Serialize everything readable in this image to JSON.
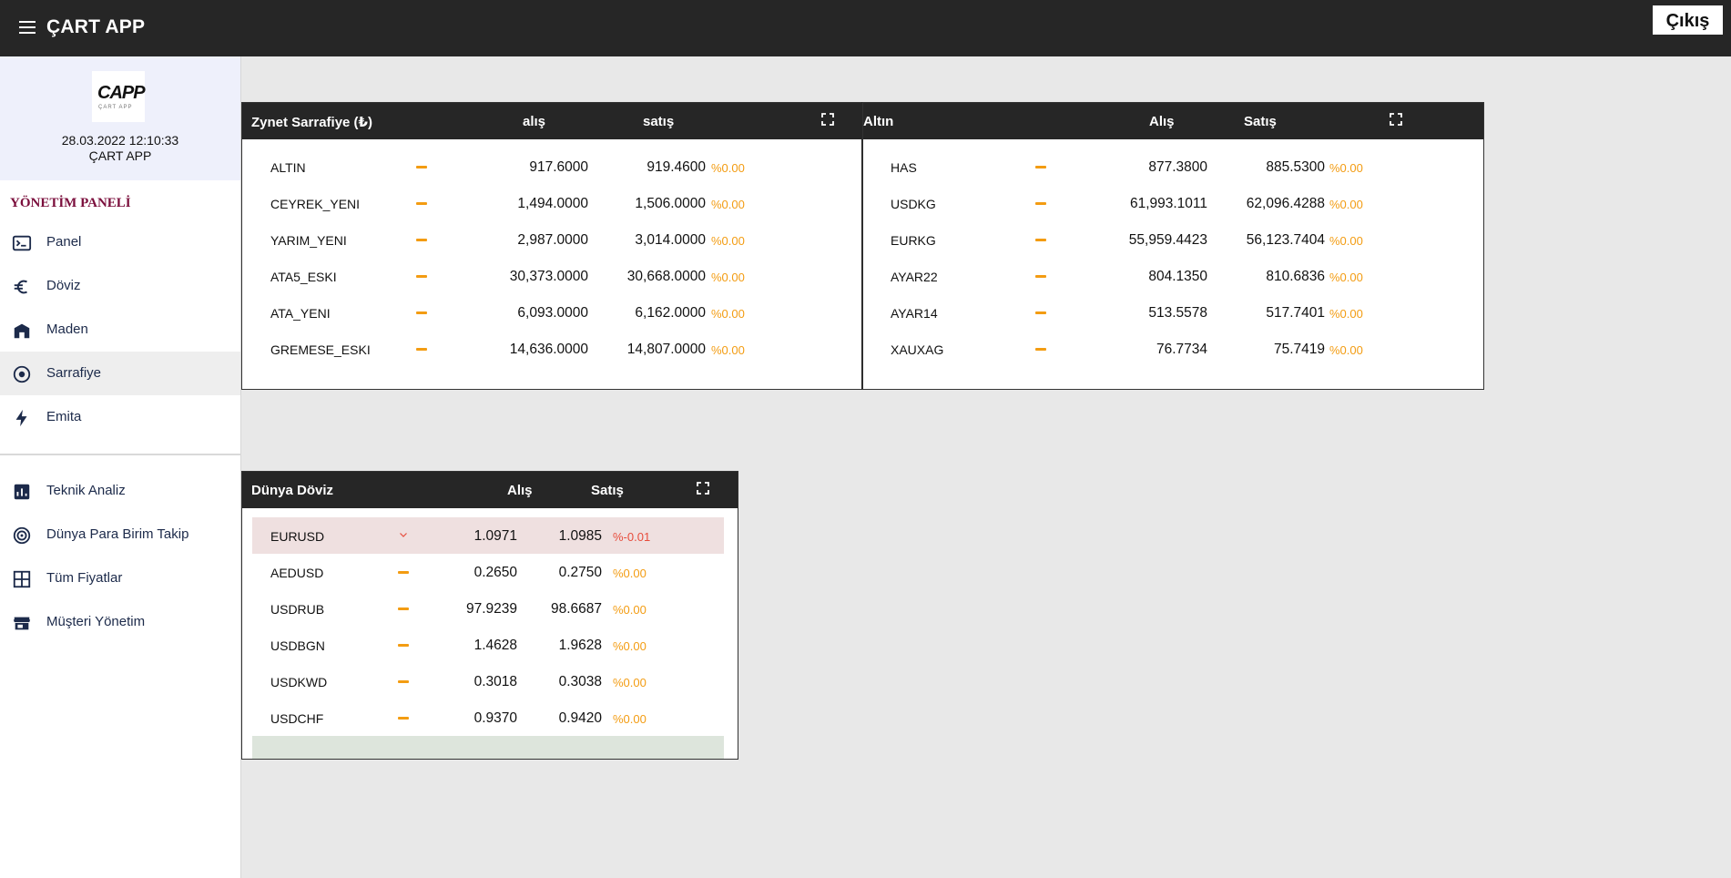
{
  "app": {
    "title": "ÇART APP",
    "logout_label": "Çıkış"
  },
  "profile": {
    "logo_text": "CAPP",
    "logo_sub": "ÇART APP",
    "datetime": "28.03.2022 12:10:33",
    "user": "ÇART APP"
  },
  "sidebar": {
    "section_title": "YÖNETİM PANELİ",
    "items": [
      {
        "label": "Panel",
        "icon": "terminal-icon"
      },
      {
        "label": "Döviz",
        "icon": "euro-icon"
      },
      {
        "label": "Maden",
        "icon": "store-icon"
      },
      {
        "label": "Sarrafiye",
        "icon": "coin-icon",
        "active": true
      },
      {
        "label": "Emita",
        "icon": "bolt-icon"
      }
    ],
    "items2": [
      {
        "label": "Teknik Analiz",
        "icon": "chart-icon"
      },
      {
        "label": "Dünya Para Birim Takip",
        "icon": "radar-icon"
      },
      {
        "label": "Tüm Fiyatlar",
        "icon": "grid-icon"
      },
      {
        "label": "Müşteri Yönetim",
        "icon": "shop-icon"
      }
    ]
  },
  "colors": {
    "topbar": "#262626",
    "neutral": "#f39c12",
    "down": "#e74c3c",
    "active_row_down": "#efe0e0",
    "row_up": "#dde5dc"
  },
  "zynet": {
    "title": "Zynet Sarrafiye (₺)",
    "buy_label": "alış",
    "sell_label": "satış",
    "rows": [
      {
        "name": "ALTIN",
        "buy": "917.6000",
        "sell": "919.4600",
        "change": "%0.00"
      },
      {
        "name": "CEYREK_YENI",
        "buy": "1,494.0000",
        "sell": "1,506.0000",
        "change": "%0.00"
      },
      {
        "name": "YARIM_YENI",
        "buy": "2,987.0000",
        "sell": "3,014.0000",
        "change": "%0.00"
      },
      {
        "name": "ATA5_ESKI",
        "buy": "30,373.0000",
        "sell": "30,668.0000",
        "change": "%0.00"
      },
      {
        "name": "ATA_YENI",
        "buy": "6,093.0000",
        "sell": "6,162.0000",
        "change": "%0.00"
      },
      {
        "name": "GREMESE_ESKI",
        "buy": "14,636.0000",
        "sell": "14,807.0000",
        "change": "%0.00"
      }
    ]
  },
  "altin": {
    "title": "Altın",
    "buy_label": "Alış",
    "sell_label": "Satış",
    "rows": [
      {
        "name": "HAS",
        "buy": "877.3800",
        "sell": "885.5300",
        "change": "%0.00"
      },
      {
        "name": "USDKG",
        "buy": "61,993.1011",
        "sell": "62,096.4288",
        "change": "%0.00"
      },
      {
        "name": "EURKG",
        "buy": "55,959.4423",
        "sell": "56,123.7404",
        "change": "%0.00"
      },
      {
        "name": "AYAR22",
        "buy": "804.1350",
        "sell": "810.6836",
        "change": "%0.00"
      },
      {
        "name": "AYAR14",
        "buy": "513.5578",
        "sell": "517.7401",
        "change": "%0.00"
      },
      {
        "name": "XAUXAG",
        "buy": "76.7734",
        "sell": "75.7419",
        "change": "%0.00"
      }
    ]
  },
  "dunya": {
    "title": "Dünya Döviz",
    "buy_label": "Alış",
    "sell_label": "Satış",
    "rows": [
      {
        "name": "EURUSD",
        "buy": "1.0971",
        "sell": "1.0985",
        "change": "%-0.01",
        "trend": "down"
      },
      {
        "name": "AEDUSD",
        "buy": "0.2650",
        "sell": "0.2750",
        "change": "%0.00"
      },
      {
        "name": "USDRUB",
        "buy": "97.9239",
        "sell": "98.6687",
        "change": "%0.00"
      },
      {
        "name": "USDBGN",
        "buy": "1.4628",
        "sell": "1.9628",
        "change": "%0.00"
      },
      {
        "name": "USDKWD",
        "buy": "0.3018",
        "sell": "0.3038",
        "change": "%0.00"
      },
      {
        "name": "USDCHF",
        "buy": "0.9370",
        "sell": "0.9420",
        "change": "%0.00"
      }
    ]
  }
}
